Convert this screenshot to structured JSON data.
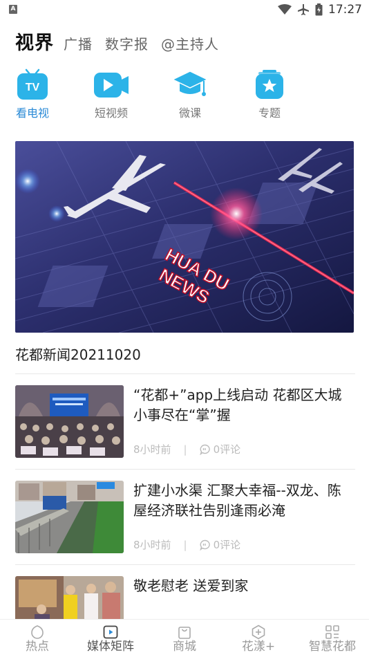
{
  "status_bar": {
    "badge": "A",
    "time": "17:27"
  },
  "top_tabs": [
    {
      "label": "视界",
      "active": true
    },
    {
      "label": "广播"
    },
    {
      "label": "数字报"
    },
    {
      "label": "@主持人"
    }
  ],
  "categories": [
    {
      "label": "看电视",
      "icon": "tv-icon",
      "active": true,
      "icon_text": "TV"
    },
    {
      "label": "短视频",
      "icon": "video-camera-icon"
    },
    {
      "label": "微课",
      "icon": "graduation-cap-icon"
    },
    {
      "label": "专题",
      "icon": "star-icon"
    }
  ],
  "hero": {
    "title": "花都新闻20211020",
    "image_text_1": "HUA DU",
    "image_text_2": "NEWS"
  },
  "news": [
    {
      "title": "“花都+”app上线启动 花都区大城小事尽在“掌”握",
      "time": "8小时前",
      "comments": "0评论"
    },
    {
      "title": "扩建小水渠 汇聚大幸福--双龙、陈屋经济联社告别逢雨必淹",
      "time": "8小时前",
      "comments": "0评论"
    },
    {
      "title": "敬老慰老 送爱到家"
    }
  ],
  "bottom_nav": [
    {
      "label": "热点",
      "icon": "hotspot-icon"
    },
    {
      "label": "媒体矩阵",
      "icon": "play-box-icon",
      "active": true
    },
    {
      "label": "商城",
      "icon": "shopping-bag-icon"
    },
    {
      "label": "花漾+",
      "icon": "plus-hexagon-icon"
    },
    {
      "label": "智慧花都",
      "icon": "grid-apps-icon"
    }
  ],
  "colors": {
    "accent": "#2a8ad6",
    "icon_bg": "#2cb3e8"
  }
}
